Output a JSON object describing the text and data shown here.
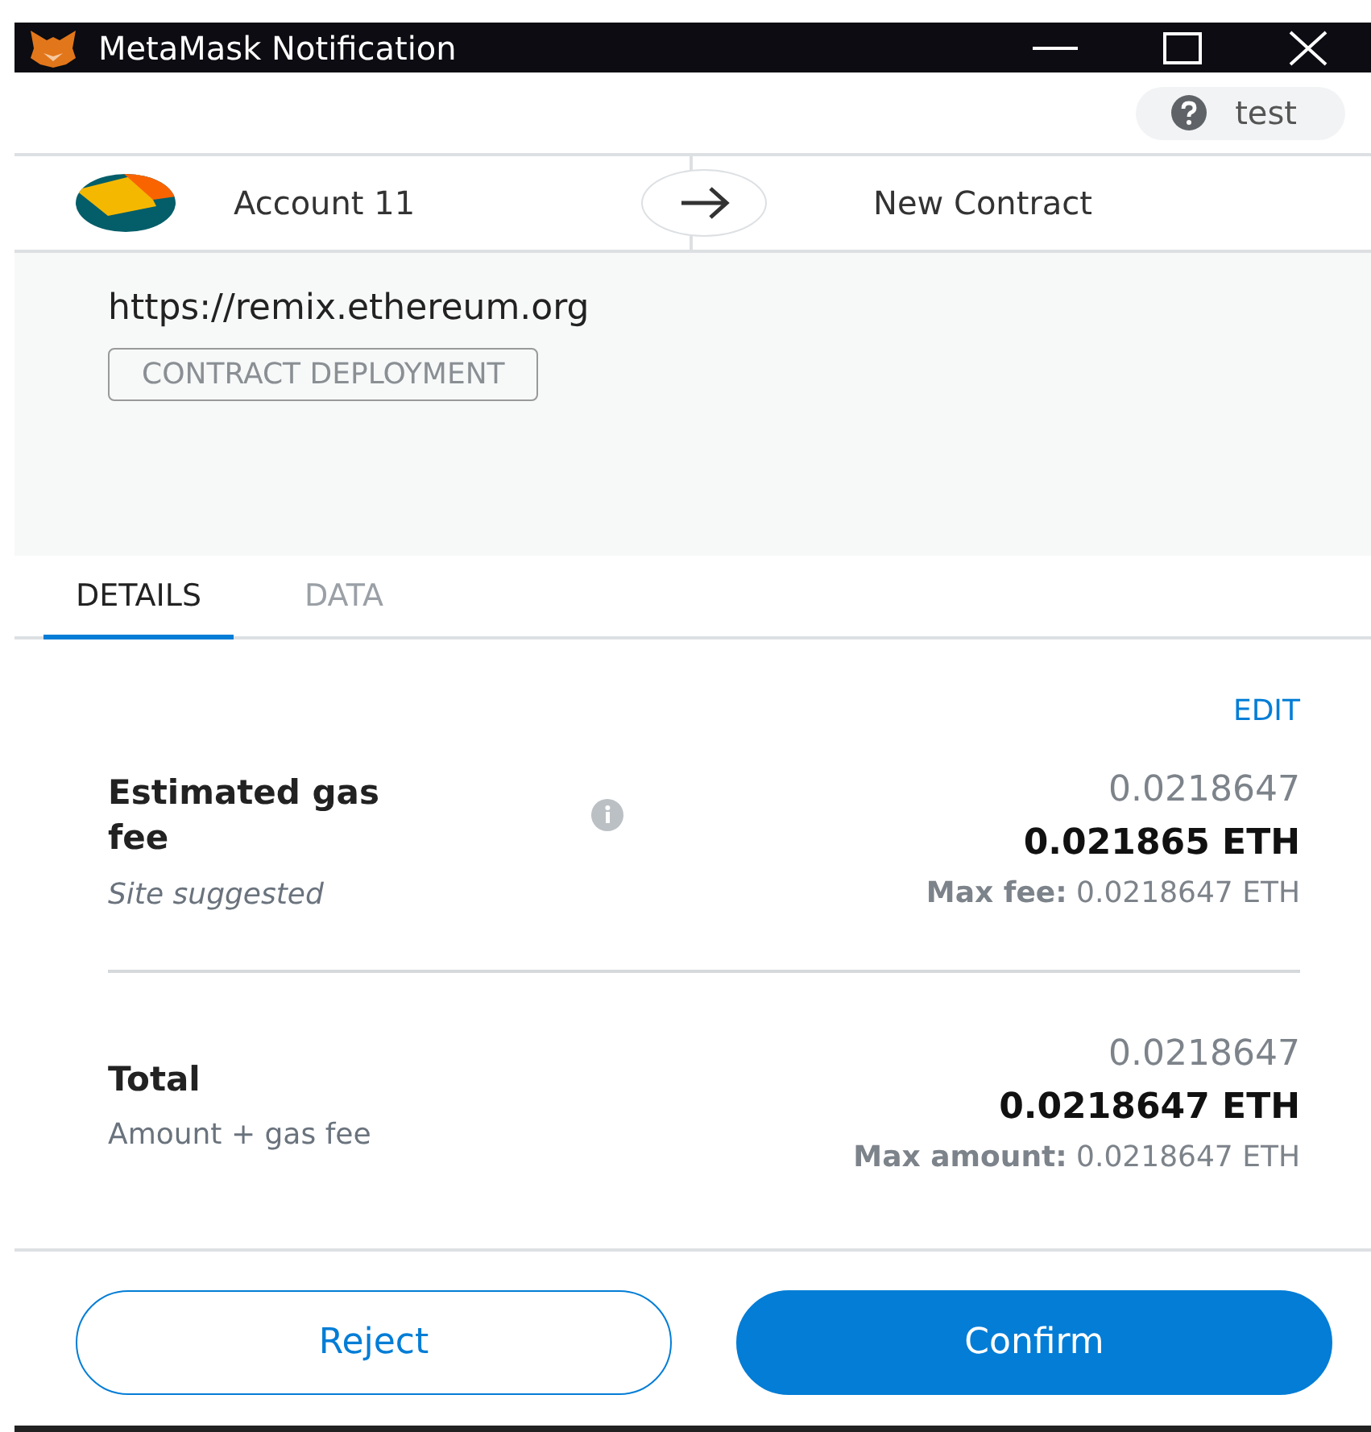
{
  "window": {
    "title": "MetaMask Notification"
  },
  "network": {
    "label": "test"
  },
  "sender": {
    "account": "Account 11"
  },
  "recipient": {
    "label": "New Contract"
  },
  "origin": {
    "url": "https://remix.ethereum.org",
    "badge": "CONTRACT DEPLOYMENT"
  },
  "tabs": [
    {
      "label": "DETAILS",
      "selected": true
    },
    {
      "label": "DATA",
      "selected": false
    }
  ],
  "edit_link": "EDIT",
  "rows": [
    {
      "kind": "gas",
      "title": "Estimated gas fee",
      "subtitle": "Site suggested",
      "secondary": "0.0218647",
      "primary": "0.021865 ETH",
      "max_label": "Max fee:",
      "max_value": "0.0218647 ETH"
    },
    {
      "kind": "total",
      "title": "Total",
      "subtitle": "Amount + gas fee",
      "secondary": "0.0218647",
      "primary": "0.0218647 ETH",
      "max_label": "Max amount:",
      "max_value": "0.0218647 ETH"
    }
  ],
  "buttons": [
    {
      "label": "Reject",
      "kind": "secondary"
    },
    {
      "label": "Confirm",
      "kind": "primary"
    }
  ]
}
